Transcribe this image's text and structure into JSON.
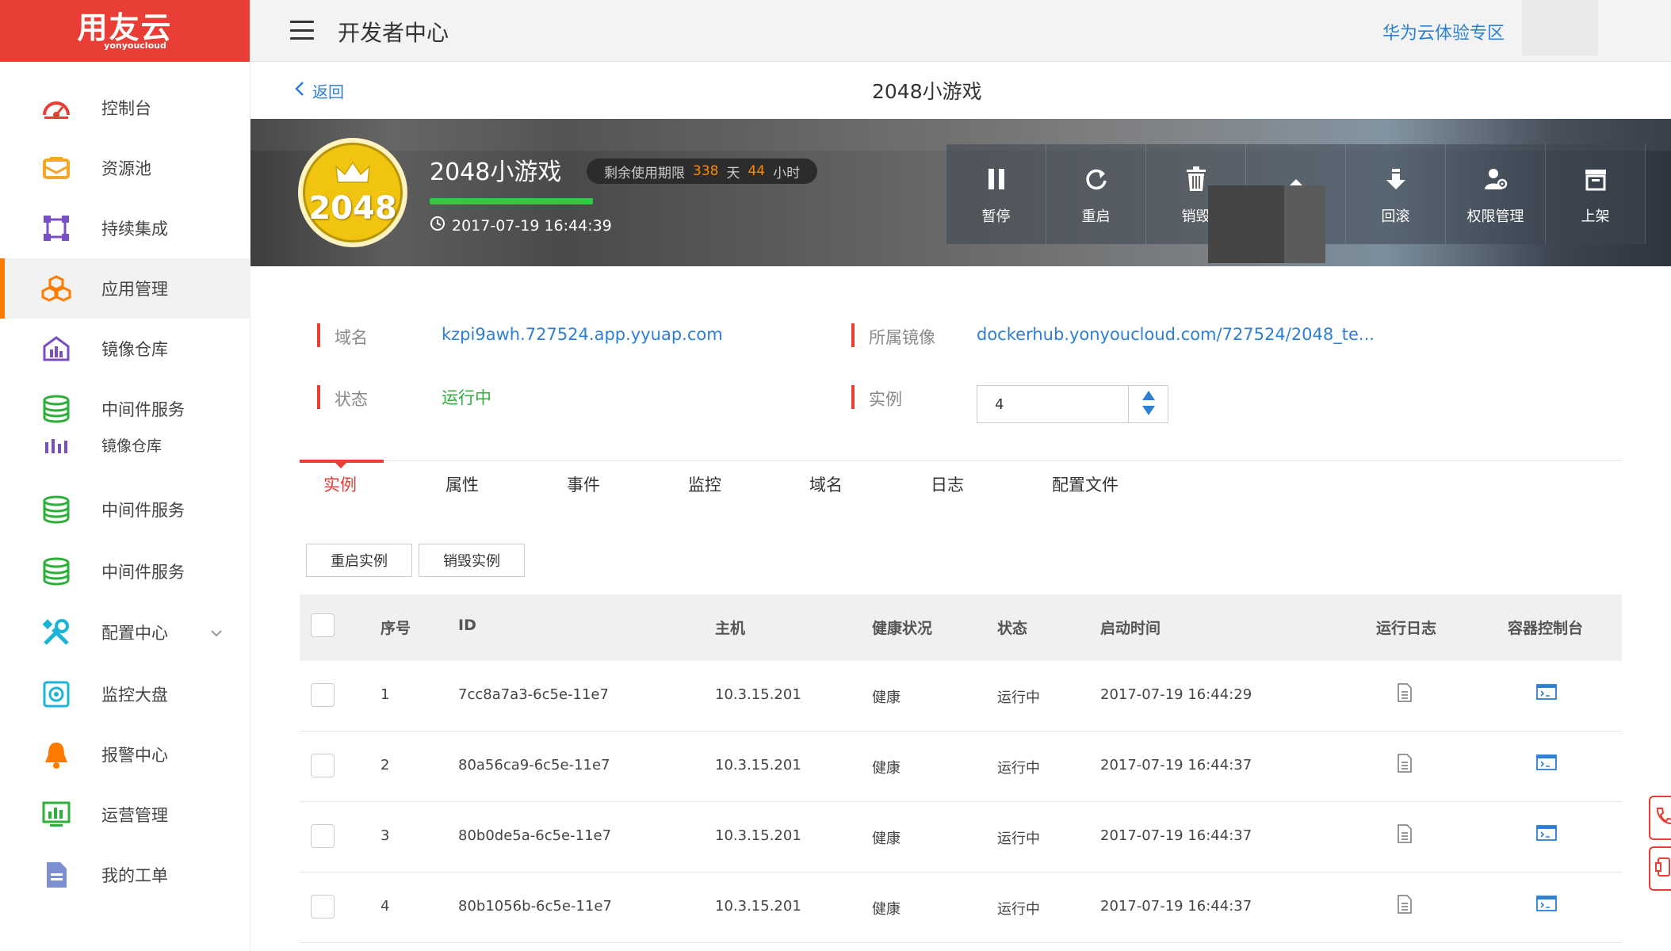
{
  "brand": {
    "logo_text": "用友云",
    "logo_sub": "yonyoucloud",
    "color": "#e83e35"
  },
  "header": {
    "title": "开发者中心",
    "right_link": "华为云体验专区"
  },
  "sidebar": {
    "items": [
      {
        "label": "控制台",
        "icon": "dashboard-icon",
        "color": "#e83e35"
      },
      {
        "label": "资源池",
        "icon": "resource-pool-icon",
        "color": "#f5a623"
      },
      {
        "label": "持续集成",
        "icon": "integration-icon",
        "color": "#7b4fc4"
      },
      {
        "label": "应用管理",
        "icon": "app-management-icon",
        "color": "#ff7a00",
        "active": true
      },
      {
        "label": "镜像仓库",
        "icon": "image-repo-icon",
        "color": "#7b4fc4"
      },
      {
        "label": "中间件服务",
        "icon": "database-icon",
        "color": "#2eaf3a"
      },
      {
        "label": "镜像仓库",
        "icon": "image-repo-icon",
        "color": "#7b4fc4",
        "partial": true
      },
      {
        "label": "中间件服务",
        "icon": "database-icon",
        "color": "#2eaf3a"
      },
      {
        "label": "中间件服务",
        "icon": "database-icon",
        "color": "#2eaf3a"
      },
      {
        "label": "配置中心",
        "icon": "tools-icon",
        "color": "#1ab4d6",
        "expandable": true
      },
      {
        "label": "监控大盘",
        "icon": "monitor-icon",
        "color": "#1ab4d6"
      },
      {
        "label": "报警中心",
        "icon": "bell-icon",
        "color": "#ff7a00"
      },
      {
        "label": "运营管理",
        "icon": "chart-screen-icon",
        "color": "#2eaf3a"
      },
      {
        "label": "我的工单",
        "icon": "document-icon",
        "color": "#7b8fd1"
      }
    ]
  },
  "subheader": {
    "back_label": "返回",
    "page_title": "2048小游戏"
  },
  "app": {
    "badge_number": "2048",
    "name": "2048小游戏",
    "created": "2017-07-19 16:44:39",
    "remain_prefix": "剩余使用期限",
    "remain_days": "338",
    "remain_days_unit": "天",
    "remain_hours": "44",
    "remain_hours_unit": "小时"
  },
  "actions": [
    {
      "label": "暂停",
      "icon": "pause-icon"
    },
    {
      "label": "重启",
      "icon": "restart-icon"
    },
    {
      "label": "销毁",
      "icon": "trash-icon"
    },
    {
      "label": "",
      "icon": "upgrade-icon"
    },
    {
      "label": "回滚",
      "icon": "rollback-icon"
    },
    {
      "label": "权限管理",
      "icon": "permission-icon"
    },
    {
      "label": "上架",
      "icon": "shelf-icon"
    }
  ],
  "info": {
    "domain_label": "域名",
    "domain_value": "kzpi9awh.727524.app.yyuap.com",
    "image_label": "所属镜像",
    "image_value": "dockerhub.yonyoucloud.com/727524/2048_te...",
    "status_label": "状态",
    "status_value": "运行中",
    "instance_label": "实例",
    "instance_value": "4"
  },
  "tabs": [
    "实例",
    "属性",
    "事件",
    "监控",
    "域名",
    "日志",
    "配置文件"
  ],
  "buttons": {
    "restart": "重启实例",
    "destroy": "销毁实例"
  },
  "table": {
    "headers": [
      "序号",
      "ID",
      "主机",
      "健康状况",
      "状态",
      "启动时间",
      "运行日志",
      "容器控制台"
    ],
    "rows": [
      {
        "no": "1",
        "id": "7cc8a7a3-6c5e-11e7",
        "host": "10.3.15.201",
        "health": "健康",
        "status": "运行中",
        "start": "2017-07-19 16:44:29"
      },
      {
        "no": "2",
        "id": "80a56ca9-6c5e-11e7",
        "host": "10.3.15.201",
        "health": "健康",
        "status": "运行中",
        "start": "2017-07-19 16:44:37"
      },
      {
        "no": "3",
        "id": "80b0de5a-6c5e-11e7",
        "host": "10.3.15.201",
        "health": "健康",
        "status": "运行中",
        "start": "2017-07-19 16:44:37"
      },
      {
        "no": "4",
        "id": "80b1056b-6c5e-11e7",
        "host": "10.3.15.201",
        "health": "健康",
        "status": "运行中",
        "start": "2017-07-19 16:44:37"
      }
    ]
  },
  "colors": {
    "accent": "#e83e35",
    "link": "#2d7fd3",
    "running": "#2eaf3a",
    "remain_highlight": "#ff8a00"
  }
}
